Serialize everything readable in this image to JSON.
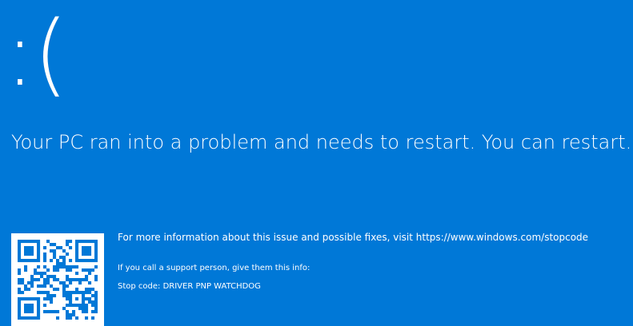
{
  "screen": {
    "background_color": "#0078d7",
    "text_color": "#ffffff",
    "sad_face": ":(",
    "headline": "Your PC ran into a problem and needs to restart. You can restart.",
    "more_info": "For more information about this issue and possible fixes, visit https://www.windows.com/stopcode",
    "support_note": "If you call a support person, give them this info:",
    "stop_code": "Stop code: DRIVER PNP WATCHDOG"
  },
  "qr_code": {
    "icon": "qr-code-icon",
    "foreground": "#0078d7",
    "background": "#ffffff"
  }
}
